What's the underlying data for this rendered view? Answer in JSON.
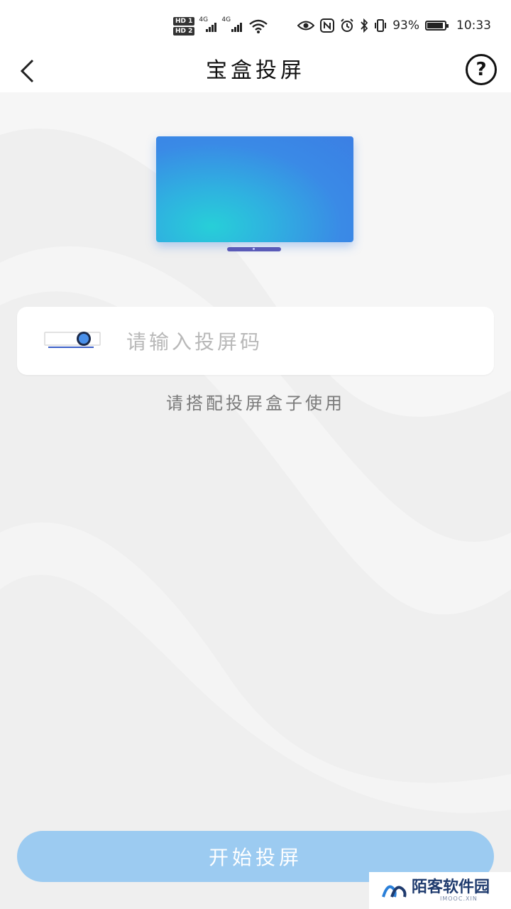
{
  "status_bar": {
    "hd1": "HD 1",
    "hd2": "HD 2",
    "net1": "4G",
    "net2": "4G",
    "battery": "93%",
    "battery_level": 0.93,
    "time": "10:33"
  },
  "nav": {
    "title": "宝盒投屏",
    "help_symbol": "?"
  },
  "code_input": {
    "value": "",
    "placeholder": "请输入投屏码"
  },
  "hint": "请搭配投屏盒子使用",
  "start_button": "开始投屏",
  "watermark": {
    "main": "陌客软件园",
    "sub": "IMOOC.XIN"
  },
  "colors": {
    "accent": "#3a8ae6",
    "button": "#9ccbf1",
    "stand": "#5a5bb8"
  }
}
